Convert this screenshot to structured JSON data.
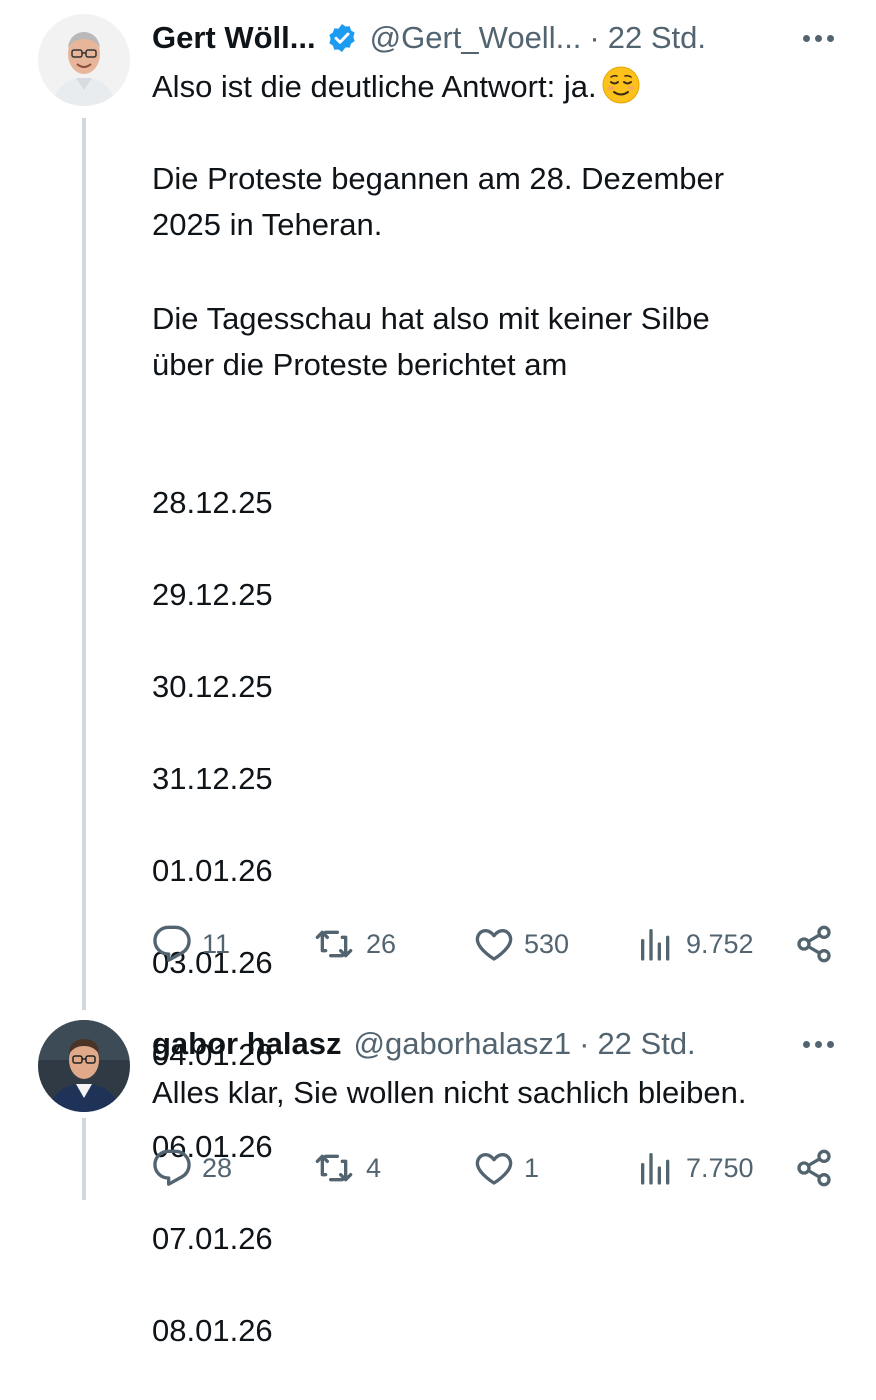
{
  "tweet1": {
    "name": "Gert Wöll...",
    "handle": "@Gert_Woell...",
    "separator": "·",
    "time": "22 Std.",
    "text_line1": "Also ist die deutliche Antwort: ja.",
    "emoji": "relieved-face-emoji",
    "paragraph2": "Die Proteste begannen am 28. Dezember\n2025 in Teheran.",
    "paragraph3": "Die Tagesschau hat also mit keiner Silbe\nüber die Proteste berichtet am",
    "dates": [
      "28.12.25",
      "29.12.25",
      "30.12.25",
      "31.12.25",
      "01.01.26",
      "03.01.26",
      "04.01.26",
      "06.01.26",
      "07.01.26",
      "08.01.26"
    ],
    "replies": "11",
    "reposts": "26",
    "likes": "530",
    "views": "9.752"
  },
  "tweet2": {
    "name": "gabor halasz",
    "handle": "@gaborhalasz1",
    "separator": "·",
    "time": "22 Std.",
    "text": "Alles klar, Sie wollen nicht sachlich bleiben.",
    "replies": "28",
    "reposts": "4",
    "likes": "1",
    "views": "7.750"
  },
  "colors": {
    "text": "#0f1419",
    "secondary": "#536471",
    "verified": "#1d9bf0",
    "thread_line": "#cfd9de"
  }
}
